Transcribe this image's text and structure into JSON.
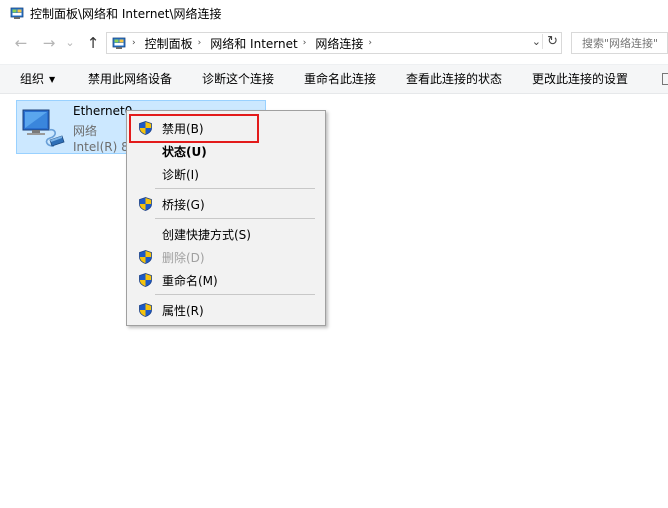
{
  "window": {
    "title": "控制面板\\网络和 Internet\\网络连接"
  },
  "nav": {
    "back": "←",
    "forward": "→",
    "history": "⌄",
    "up": "↑"
  },
  "address": {
    "crumbs": [
      "控制面板",
      "网络和 Internet",
      "网络连接"
    ],
    "dropdown": "⌄",
    "refresh": "↻"
  },
  "search": {
    "placeholder": "搜索\"网络连接\""
  },
  "toolbar": {
    "organize": "组织",
    "disable_device": "禁用此网络设备",
    "diagnose": "诊断这个连接",
    "rename": "重命名此连接",
    "view_status": "查看此连接的状态",
    "change_settings": "更改此连接的设置"
  },
  "connection": {
    "name": "Ethernet0",
    "type": "网络",
    "adapter": "Intel(R) 8"
  },
  "context_menu": {
    "disable": "禁用(B)",
    "status": "状态(U)",
    "diagnose": "诊断(I)",
    "bridge": "桥接(G)",
    "create_shortcut": "创建快捷方式(S)",
    "delete": "删除(D)",
    "rename": "重命名(M)",
    "properties": "属性(R)"
  },
  "colors": {
    "selection_bg": "#cce8ff",
    "selection_border": "#99d1ff",
    "highlight": "#e31b1b",
    "menu_bg": "#f2f2f2"
  }
}
